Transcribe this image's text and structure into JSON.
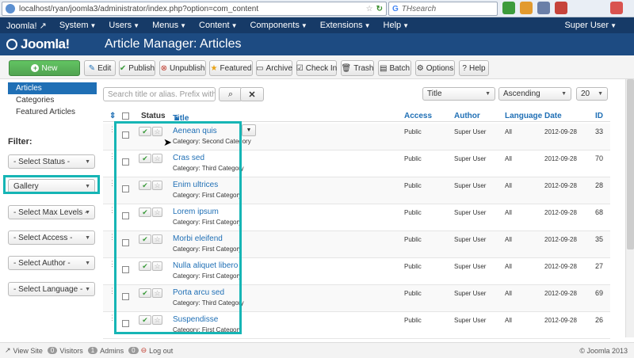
{
  "browser": {
    "url": "localhost/ryan/joomla3/administrator/index.php?option=com_content",
    "search_placeholder": "THsearch"
  },
  "topmenu": {
    "items": [
      {
        "label": "Joomla!"
      },
      {
        "label": "System"
      },
      {
        "label": "Users"
      },
      {
        "label": "Menus"
      },
      {
        "label": "Content"
      },
      {
        "label": "Components"
      },
      {
        "label": "Extensions"
      },
      {
        "label": "Help"
      }
    ],
    "user": "Super User"
  },
  "header": {
    "logo_text": "Joomla!",
    "title": "Article Manager: Articles"
  },
  "toolbar": {
    "new": "New",
    "edit": "Edit",
    "publish": "Publish",
    "unpublish": "Unpublish",
    "featured": "Featured",
    "archive": "Archive",
    "checkin": "Check In",
    "trash": "Trash",
    "batch": "Batch",
    "options": "Options",
    "help": "Help"
  },
  "sidebar": {
    "items": [
      {
        "label": "Articles"
      },
      {
        "label": "Categories"
      },
      {
        "label": "Featured Articles"
      }
    ],
    "filter_label": "Filter:",
    "filters": [
      {
        "value": "- Select Status -"
      },
      {
        "value": "Gallery"
      },
      {
        "value": "- Select Max Levels -"
      },
      {
        "value": "- Select Access -"
      },
      {
        "value": "- Select Author -"
      },
      {
        "value": "- Select Language -"
      }
    ]
  },
  "search": {
    "placeholder": "Search title or alias. Prefix with ID: to"
  },
  "sort": {
    "field": "Title",
    "direction": "Ascending",
    "limit": "20"
  },
  "table": {
    "headers": {
      "status": "Status",
      "title": "Title",
      "access": "Access",
      "author": "Author",
      "language": "Language",
      "date": "Date",
      "id": "ID"
    },
    "rows": [
      {
        "title": "Aenean quis",
        "category": "Category: Second Category",
        "access": "Public",
        "author": "Super User",
        "language": "All",
        "date": "2012-09-28",
        "id": "33"
      },
      {
        "title": "Cras sed",
        "category": "Category: Third Category",
        "access": "Public",
        "author": "Super User",
        "language": "All",
        "date": "2012-09-28",
        "id": "70"
      },
      {
        "title": "Enim ultrices",
        "category": "Category: First Category",
        "access": "Public",
        "author": "Super User",
        "language": "All",
        "date": "2012-09-28",
        "id": "28"
      },
      {
        "title": "Lorem ipsum",
        "category": "Category: First Category",
        "access": "Public",
        "author": "Super User",
        "language": "All",
        "date": "2012-09-28",
        "id": "68"
      },
      {
        "title": "Morbi eleifend",
        "category": "Category: First Category",
        "access": "Public",
        "author": "Super User",
        "language": "All",
        "date": "2012-09-28",
        "id": "35"
      },
      {
        "title": "Nulla aliquet libero",
        "category": "Category: First Category",
        "access": "Public",
        "author": "Super User",
        "language": "All",
        "date": "2012-09-28",
        "id": "27"
      },
      {
        "title": "Porta arcu sed",
        "category": "Category: Third Category",
        "access": "Public",
        "author": "Super User",
        "language": "All",
        "date": "2012-09-28",
        "id": "69"
      },
      {
        "title": "Suspendisse",
        "category": "Category: First Category",
        "access": "Public",
        "author": "Super User",
        "language": "All",
        "date": "2012-09-28",
        "id": "26"
      }
    ]
  },
  "status": {
    "view_site": "View Site",
    "visitors_count": "0",
    "visitors": "Visitors",
    "admins_count": "1",
    "admins": "Admins",
    "logout_count": "0",
    "logout": "Log out",
    "copyright": "© Joomla 2013"
  },
  "colors": {
    "menu_bg": "#163a67",
    "header_bg": "#1d4b82",
    "highlight": "#16b5b5",
    "link": "#1f6fb5"
  }
}
